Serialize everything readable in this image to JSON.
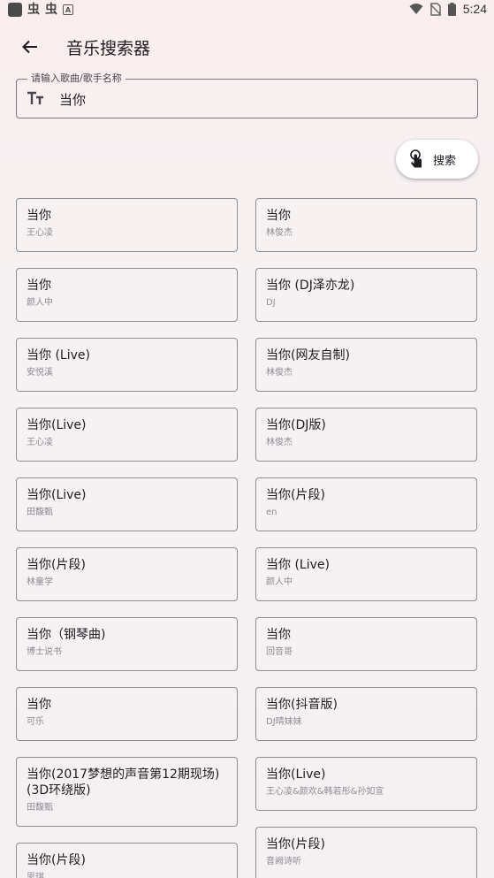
{
  "status_bar": {
    "glyph1": "虫",
    "glyph2": "虫",
    "a_badge": "A",
    "time": "5:24"
  },
  "app_bar": {
    "title": "音乐搜索器",
    "back_icon": "arrow-left-icon"
  },
  "search": {
    "label": "请输入歌曲/歌手名称",
    "value": "当你",
    "icon": "text-size-icon"
  },
  "search_button": {
    "label": "搜索",
    "icon": "touch-icon"
  },
  "results": [
    {
      "title": "当你",
      "artist": "王心凌"
    },
    {
      "title": "当你",
      "artist": "林俊杰"
    },
    {
      "title": "当你",
      "artist": "颜人中"
    },
    {
      "title": "当你 (DJ泽亦龙)",
      "artist": "DJ"
    },
    {
      "title": "当你 (Live)",
      "artist": "安悦溪"
    },
    {
      "title": "当你(网友自制)",
      "artist": "林俊杰"
    },
    {
      "title": "当你(Live)",
      "artist": "王心凌"
    },
    {
      "title": "当你(DJ版)",
      "artist": "林俊杰"
    },
    {
      "title": "当你(Live)",
      "artist": "田馥甄"
    },
    {
      "title": "当你(片段)",
      "artist": "en"
    },
    {
      "title": "当你(片段)",
      "artist": "林童学"
    },
    {
      "title": "当你 (Live)",
      "artist": "颜人中"
    },
    {
      "title": "当你（钢琴曲)",
      "artist": "博士说书"
    },
    {
      "title": "当你",
      "artist": "回音哥"
    },
    {
      "title": "当你",
      "artist": "可乐"
    },
    {
      "title": "当你(抖音版)",
      "artist": "DJ晴妹妹"
    },
    {
      "title": "当你(2017梦想的声音第12期现场)(3D环绕版)",
      "artist": "田馥甄"
    },
    {
      "title": "当你(Live)",
      "artist": "王心凌&颜欢&韩若彤&孙如宣"
    },
    {
      "title": "当你(片段)",
      "artist": "思琪"
    },
    {
      "title": "当你(片段)",
      "artist": "音阙诗听"
    }
  ]
}
